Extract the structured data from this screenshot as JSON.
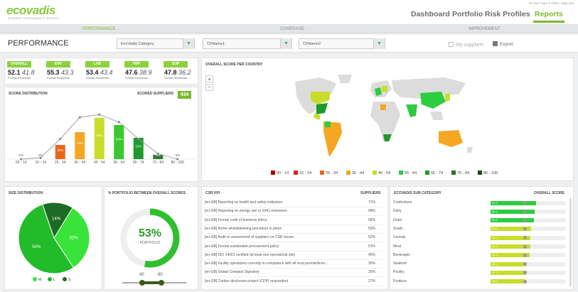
{
  "header": {
    "logo": "ecovadis",
    "logo_tagline": "BUSINESS SUSTAINABILITY RATINGS",
    "user_line": "Hi User Type X FIRS | Sign Out",
    "nav": [
      "Dashboard",
      "Portfolio",
      "Risk Profiles",
      "Reports"
    ]
  },
  "tabs": [
    "PERFORMANCE",
    "COVERAGE",
    "IMPROVEMENT"
  ],
  "filters": {
    "title": "PERFORMANCE",
    "category": "EcoVadis Category",
    "cf1": "CFName1",
    "cf2": "CFName2",
    "my_suppliers": "My suppliers",
    "export": "Export"
  },
  "kpis": [
    {
      "label": "OVERALL",
      "score": "52.1",
      "bench": "41.8",
      "sub": "Portfolio Benchmark",
      "color": "#8bd13e"
    },
    {
      "label": "ENV",
      "score": "55.3",
      "bench": "43.3",
      "sub": "Portfolio Benchmark",
      "color": "#8bd13e"
    },
    {
      "label": "LAB",
      "score": "53.4",
      "bench": "43.4",
      "sub": "Portfolio Benchmark",
      "color": "#8bd13e"
    },
    {
      "label": "FBP",
      "score": "47.6",
      "bench": "38.9",
      "sub": "Portfolio Benchmark",
      "color": "#8bd13e"
    },
    {
      "label": "SUP",
      "score": "47.8",
      "bench": "36.2",
      "sub": "Portfolio Benchmark",
      "color": "#8bd13e"
    }
  ],
  "score_dist": {
    "title": "SCORE DISTRIBUTION",
    "scored_label": "SCORED SUPPLIERS",
    "scored_count": "434"
  },
  "chart_data": {
    "type": "bar",
    "categories": [
      "00 - 14",
      "15 - 24",
      "25 - 34",
      "35 - 44",
      "45 - 54",
      "55 - 64",
      "65 - 74",
      "75 - 84",
      "85 - 100"
    ],
    "values": [
      0,
      0,
      10,
      19,
      29,
      24,
      15,
      3,
      0
    ],
    "data_labels": [
      "0%",
      "0%",
      "10%",
      "19%",
      "29%",
      "24%",
      "15%",
      "3%",
      "0%"
    ],
    "colors": [
      "#c00000",
      "#e03020",
      "#e8681a",
      "#f5a623",
      "#c8dc2a",
      "#39c92f",
      "#1e9a2a",
      "#2c7a2a",
      "#205a20"
    ],
    "line": [
      0,
      2,
      30,
      62,
      66,
      55,
      30,
      8,
      0
    ]
  },
  "map": {
    "title": "OVERALL SCORE PER COUNTRY",
    "legend": [
      {
        "label": "00 - 14",
        "color": "#b00000"
      },
      {
        "label": "15 - 24",
        "color": "#e02020"
      },
      {
        "label": "25 - 34",
        "color": "#e8681a"
      },
      {
        "label": "35 - 44",
        "color": "#f5a623"
      },
      {
        "label": "45 - 54",
        "color": "#c8dc2a"
      },
      {
        "label": "55 - 64",
        "color": "#2ecc40"
      },
      {
        "label": "65 - 74",
        "color": "#1e9a2a"
      },
      {
        "label": "75 - 84",
        "color": "#2c6e2a"
      },
      {
        "label": "85 - 100",
        "color": "#1b4a1b"
      }
    ]
  },
  "size_dist": {
    "title": "SIZE DISTRIBUTION",
    "slices": [
      {
        "label": "M",
        "value": 32
      },
      {
        "label": "L",
        "value": 54
      },
      {
        "label": "S",
        "value": 14
      }
    ],
    "slice_labels": [
      "32%",
      "54%",
      "14%"
    ],
    "colors": [
      "#39e33a",
      "#22bb2a",
      "#1e6b25"
    ]
  },
  "portfolio": {
    "title": "% PORTFOLIO BETWEEN OVERALL SCORES",
    "percent": "53%",
    "sub": "PORTFOLIO",
    "fill": 0.53,
    "low": "40",
    "high": "60"
  },
  "kpi_table": {
    "title": "CSR KPI",
    "col": "SUPPLIERS",
    "rows": [
      [
        "[en-GB] Reporting on health and safety indicators",
        "71%"
      ],
      [
        "[en-GB] Reporting on energy use or GHG emissions",
        "68%"
      ],
      [
        "[en-GB] Formal code of business ethics",
        "59%"
      ],
      [
        "[en-GB] Active whistleblowing procedure in place",
        "53%"
      ],
      [
        "[en-GB] Audit or assessment of suppliers on CSR issues",
        "52%"
      ],
      [
        "[en-GB] Formal sustainable procurement policy",
        "51%"
      ],
      [
        "[en-GB] ISO 14001 certified (at least one operational site)",
        "45%"
      ],
      [
        "[en-GB] Facility operations currently in compliance with all local permits/licen...",
        "35%"
      ],
      [
        "[en-GB] Global Compact Signatory",
        "35%"
      ],
      [
        "[en-GB] Carbon disclosure project (CDP) respondent",
        "27%"
      ]
    ]
  },
  "subcat": {
    "title": "ECOVADIS SUB CATEGORY",
    "col": "OVERALL SCORE",
    "rows": [
      {
        "name": "Confections",
        "score": "61.2",
        "fill": 0.61
      },
      {
        "name": "Dairy",
        "score": "59.1",
        "fill": 0.59
      },
      {
        "name": "Grain",
        "score": "58.4",
        "fill": 0.58
      },
      {
        "name": "Snails",
        "score": "53.8",
        "fill": 0.54
      },
      {
        "name": "Cereals",
        "score": "52.7",
        "fill": 0.53
      },
      {
        "name": "Meat",
        "score": "52.5",
        "fill": 0.53
      },
      {
        "name": "Beverages",
        "score": "52.2",
        "fill": 0.52
      },
      {
        "name": "Seafood",
        "score": "48.4",
        "fill": 0.48
      },
      {
        "name": "Poultry",
        "score": "47.7",
        "fill": 0.48
      },
      {
        "name": "Produce",
        "score": "45.6",
        "fill": 0.46
      }
    ]
  }
}
